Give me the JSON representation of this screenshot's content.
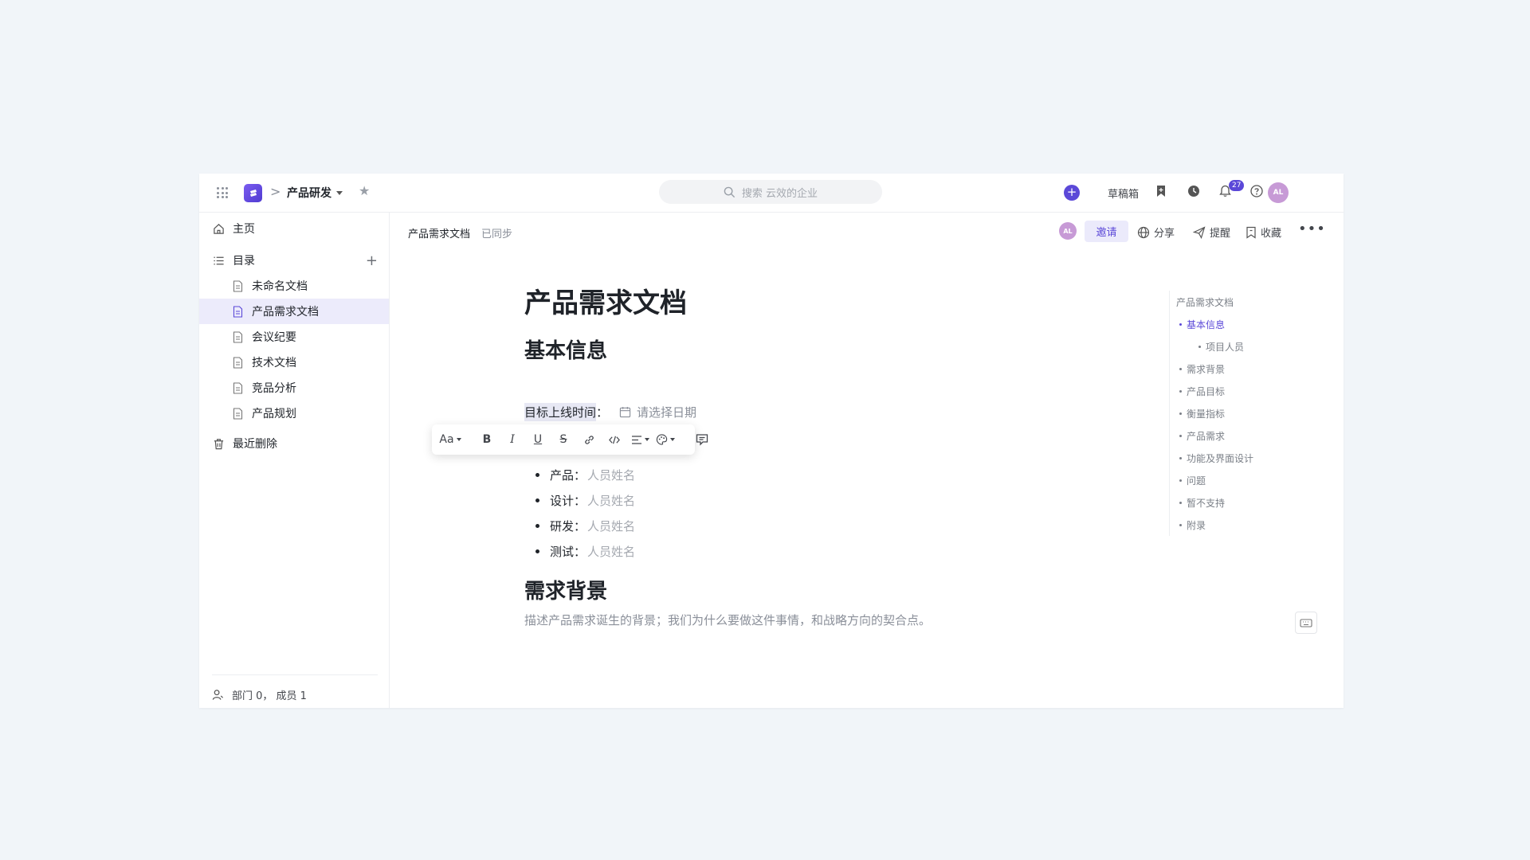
{
  "topbar": {
    "project_name": "产品研发",
    "crumb_separator": ">",
    "search_placeholder": "搜索 云效的企业",
    "drafts_label": "草稿箱",
    "notification_count": "27",
    "user_initials": "AL"
  },
  "sidebar": {
    "home_label": "主页",
    "toc_label": "目录",
    "docs": [
      {
        "label": "未命名文档"
      },
      {
        "label": "产品需求文档"
      },
      {
        "label": "会议纪要"
      },
      {
        "label": "技术文档"
      },
      {
        "label": "竞品分析"
      },
      {
        "label": "产品规划"
      }
    ],
    "trash_label": "最近删除",
    "footer_label": "部门 0， 成员 1"
  },
  "doc_header": {
    "doc_name": "产品需求文档",
    "sync_status": "已同步",
    "user_initials": "AL",
    "invite_label": "邀请",
    "share_label": "分享",
    "remind_label": "提醒",
    "favorite_label": "收藏"
  },
  "doc": {
    "title": "产品需求文档",
    "section1": "基本信息",
    "target_date_label": "目标上线时间",
    "target_date_colon": "：",
    "date_placeholder": "请选择日期",
    "people": [
      {
        "role": "产品",
        "placeholder": "人员姓名"
      },
      {
        "role": "设计",
        "placeholder": "人员姓名"
      },
      {
        "role": "研发",
        "placeholder": "人员姓名"
      },
      {
        "role": "测试",
        "placeholder": "人员姓名"
      }
    ],
    "people_colon": "：",
    "section2": "需求背景",
    "section2_desc": "描述产品需求诞生的背景；我们为什么要做这件事情，和战略方向的契合点。"
  },
  "toolbar": {
    "font_label": "Aa",
    "bold": "B",
    "italic": "I",
    "underline": "U",
    "strike": "S"
  },
  "outline": {
    "title": "产品需求文档",
    "items": [
      {
        "label": "基本信息",
        "active": true
      },
      {
        "label": "项目人员",
        "sub": true
      },
      {
        "label": "需求背景"
      },
      {
        "label": "产品目标"
      },
      {
        "label": "衡量指标"
      },
      {
        "label": "产品需求"
      },
      {
        "label": "功能及界面设计"
      },
      {
        "label": "问题"
      },
      {
        "label": "暂不支持"
      },
      {
        "label": "附录"
      }
    ]
  },
  "colors": {
    "accent": "#5b48d8",
    "active_bg": "#ecebfb",
    "page_bg": "#f1f5f9"
  }
}
